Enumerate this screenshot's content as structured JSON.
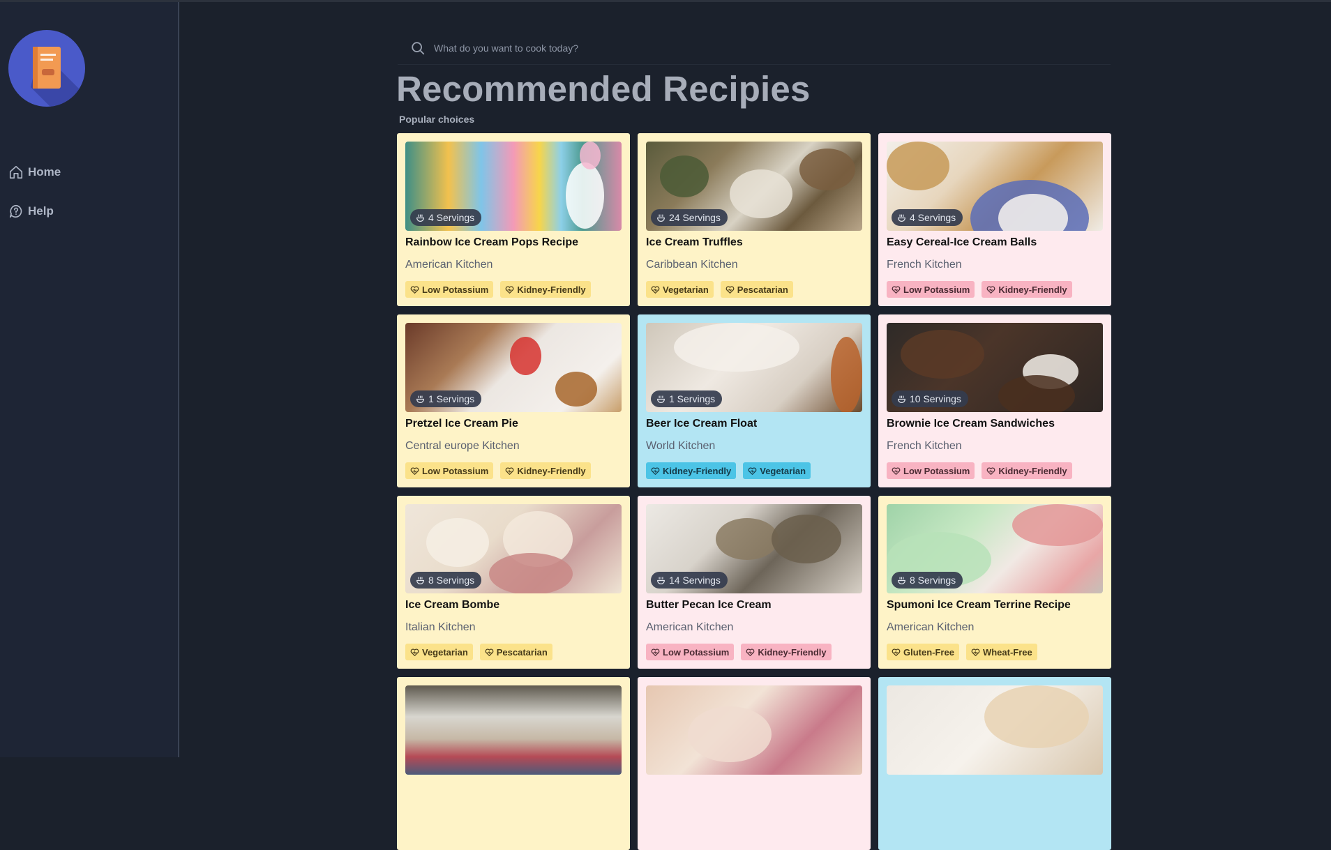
{
  "sidebar": {
    "items": [
      {
        "label": "Home",
        "icon": "home-icon"
      },
      {
        "label": "Help",
        "icon": "help-icon"
      }
    ]
  },
  "search": {
    "placeholder": "What do you want to cook today?"
  },
  "header": {
    "title": "Recommended Recipies",
    "subtitle": "Popular choices"
  },
  "colors": {
    "background": "#1b212c",
    "sidebar": "#1e2535",
    "card_yellow": "#fef3c7",
    "card_pink": "#feeaee",
    "card_blue": "#b3e5f3",
    "tag_yellow": "#fbe28a",
    "tag_pink": "#f8b3c2",
    "tag_blue": "#4cc4e6",
    "logo": "#4a5ac9"
  },
  "recipes": [
    {
      "servings": "4 Servings",
      "title": "Rainbow Ice Cream Pops Recipe",
      "kitchen": "American Kitchen",
      "tags": [
        "Low Potassium",
        "Kidney-Friendly"
      ],
      "theme": "yellow"
    },
    {
      "servings": "24 Servings",
      "title": "Ice Cream Truffles",
      "kitchen": "Caribbean Kitchen",
      "tags": [
        "Vegetarian",
        "Pescatarian"
      ],
      "theme": "yellow"
    },
    {
      "servings": "4 Servings",
      "title": "Easy Cereal-Ice Cream Balls",
      "kitchen": "French Kitchen",
      "tags": [
        "Low Potassium",
        "Kidney-Friendly"
      ],
      "theme": "pink"
    },
    {
      "servings": "1 Servings",
      "title": "Pretzel Ice Cream Pie",
      "kitchen": "Central europe Kitchen",
      "tags": [
        "Low Potassium",
        "Kidney-Friendly"
      ],
      "theme": "yellow"
    },
    {
      "servings": "1 Servings",
      "title": "Beer Ice Cream Float",
      "kitchen": "World Kitchen",
      "tags": [
        "Kidney-Friendly",
        "Vegetarian"
      ],
      "theme": "blue"
    },
    {
      "servings": "10 Servings",
      "title": "Brownie Ice Cream Sandwiches",
      "kitchen": "French Kitchen",
      "tags": [
        "Low Potassium",
        "Kidney-Friendly"
      ],
      "theme": "pink"
    },
    {
      "servings": "8 Servings",
      "title": "Ice Cream Bombe",
      "kitchen": "Italian Kitchen",
      "tags": [
        "Vegetarian",
        "Pescatarian"
      ],
      "theme": "yellow"
    },
    {
      "servings": "14 Servings",
      "title": "Butter Pecan Ice Cream",
      "kitchen": "American Kitchen",
      "tags": [
        "Low Potassium",
        "Kidney-Friendly"
      ],
      "theme": "pink"
    },
    {
      "servings": "8 Servings",
      "title": "Spumoni Ice Cream Terrine Recipe",
      "kitchen": "American Kitchen",
      "tags": [
        "Gluten-Free",
        "Wheat-Free"
      ],
      "theme": "yellow"
    },
    {
      "servings": "",
      "title": "",
      "kitchen": "",
      "tags": [],
      "theme": "yellow"
    },
    {
      "servings": "",
      "title": "",
      "kitchen": "",
      "tags": [],
      "theme": "pink"
    },
    {
      "servings": "",
      "title": "",
      "kitchen": "",
      "tags": [],
      "theme": "blue"
    }
  ]
}
